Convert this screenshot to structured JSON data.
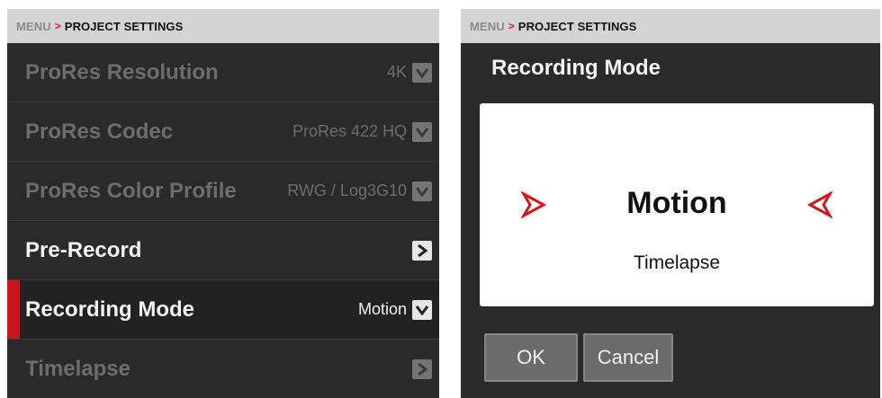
{
  "left_screen": {
    "breadcrumb": {
      "root": "MENU",
      "separator": ">",
      "current": "PROJECT SETTINGS"
    },
    "rows": [
      {
        "label": "ProRes Resolution",
        "value": "4K",
        "icon": "chevron-down-icon",
        "state": "disabled"
      },
      {
        "label": "ProRes Codec",
        "value": "ProRes 422 HQ",
        "icon": "chevron-down-icon",
        "state": "disabled"
      },
      {
        "label": "ProRes Color Profile",
        "value": "RWG / Log3G10",
        "icon": "chevron-down-icon",
        "state": "disabled"
      },
      {
        "label": "Pre-Record",
        "value": "",
        "icon": "chevron-right-icon",
        "state": "enabled"
      },
      {
        "label": "Recording Mode",
        "value": "Motion",
        "icon": "chevron-down-icon",
        "state": "selected"
      },
      {
        "label": "Timelapse",
        "value": "",
        "icon": "chevron-right-icon",
        "state": "disabled"
      }
    ]
  },
  "right_screen": {
    "breadcrumb": {
      "root": "MENU",
      "separator": ">",
      "current": "PROJECT SETTINGS"
    },
    "dialog_title": "Recording Mode",
    "selector": {
      "current": "Motion",
      "next": "Timelapse"
    },
    "buttons": {
      "ok": "OK",
      "cancel": "Cancel"
    }
  },
  "colors": {
    "accent": "#e4161b",
    "selected_marker": "#c8141a",
    "panel_bg": "#2a2a2a",
    "header_bg": "#d4d4d4",
    "disabled_text": "#6d6d6d"
  }
}
